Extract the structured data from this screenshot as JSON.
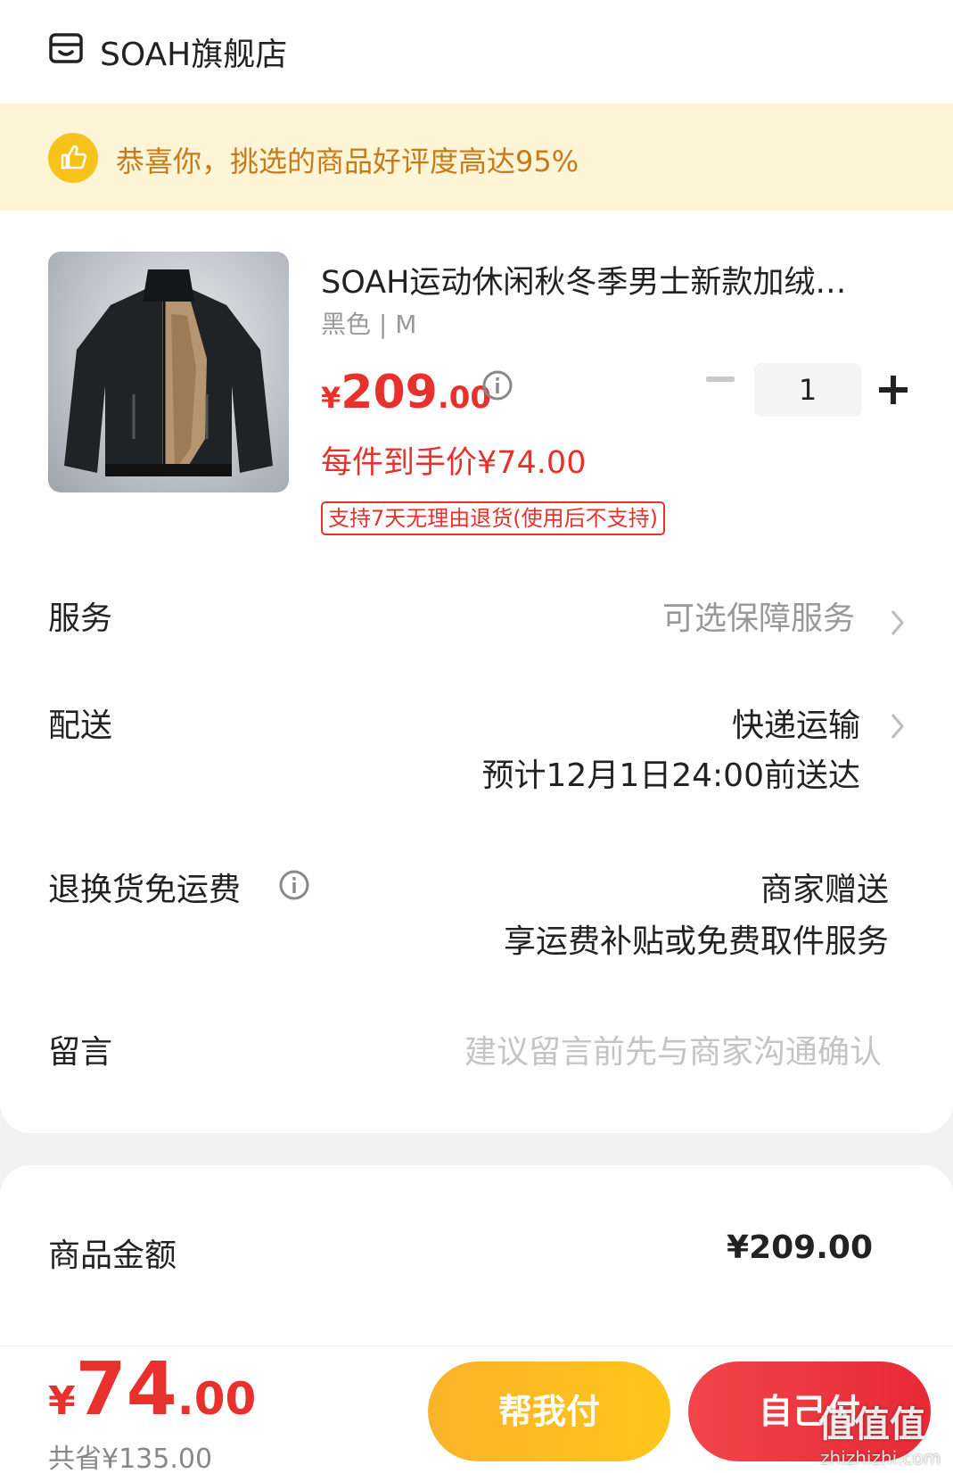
{
  "store": {
    "name": "SOAH旗舰店",
    "icon": "store-icon"
  },
  "banner": {
    "text": "恭喜你，挑选的商品好评度高达95%",
    "icon": "thumbs-up-icon",
    "bg_color": "#fdf5d6",
    "text_color": "#c77a1a"
  },
  "product": {
    "title": "SOAH运动休闲秋冬季男士新款加绒…",
    "spec": "黑色 | M",
    "price": {
      "currency": "¥",
      "integer": "209",
      "decimal": ".00"
    },
    "quantity": "1",
    "unit_price": "每件到手价¥74.00",
    "return_tag": "支持7天无理由退货(使用后不支持)",
    "image_icon": "jacket-image"
  },
  "rows": {
    "service": {
      "label": "服务",
      "value": "可选保障服务"
    },
    "delivery": {
      "label": "配送",
      "value": "快递运输",
      "sub": "预计12月1日24:00前送达"
    },
    "return_shipping": {
      "label": "退换货免运费",
      "value": "商家赠送",
      "sub": "享运费补贴或免费取件服务"
    },
    "message": {
      "label": "留言",
      "placeholder": "建议留言前先与商家沟通确认"
    }
  },
  "summary": {
    "goods_amount_label": "商品金额",
    "goods_amount_value": "¥209.00"
  },
  "bottom": {
    "total": {
      "currency": "¥",
      "integer": "74",
      "decimal": ".00"
    },
    "saved": "共省¥135.00",
    "help_pay_label": "帮我付",
    "self_pay_label": "自己付"
  },
  "watermark": {
    "text": "值值值",
    "sub": "zhizhizhi.com"
  },
  "colors": {
    "accent_red": "#e8312d",
    "accent_yellow": "#f9b32a"
  }
}
